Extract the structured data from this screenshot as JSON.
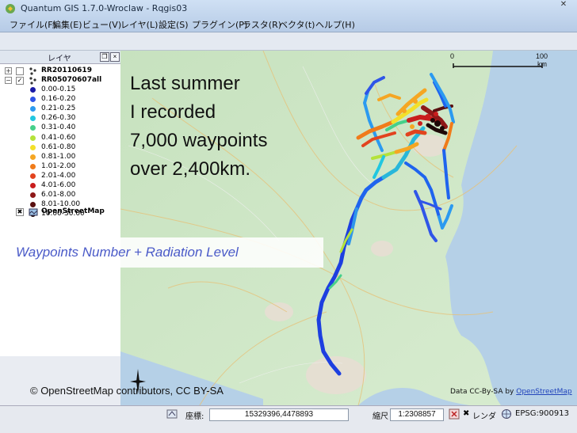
{
  "window": {
    "title": "Quantum GIS 1.7.0-Wroclaw - Rqgis03",
    "close_glyph": "✕"
  },
  "menu": [
    "ファイル(F)",
    "編集(E)",
    "ビュー(V)",
    "レイヤ(L)",
    "設定(S)",
    "プラグイン(P)",
    "ラスタ(R)",
    "ベクタ(t)",
    "ヘルプ(H)"
  ],
  "layers_panel": {
    "title": "レイヤ",
    "layers": [
      {
        "name": "RR20110619",
        "bold": true,
        "expander": "+"
      },
      {
        "name": "RR05070607all",
        "bold": true,
        "expander": "−"
      },
      {
        "name": "0.00-0.15",
        "color": "#1a1aa6"
      },
      {
        "name": "0.16-0.20",
        "color": "#2f55e8"
      },
      {
        "name": "0.21-0.25",
        "color": "#2b9af0"
      },
      {
        "name": "0.26-0.30",
        "color": "#21c7e0"
      },
      {
        "name": "0.31-0.40",
        "color": "#46d08a"
      },
      {
        "name": "0.41-0.60",
        "color": "#b4e23a"
      },
      {
        "name": "0.61-0.80",
        "color": "#f3e02a"
      },
      {
        "name": "0.81-1.00",
        "color": "#f5a623"
      },
      {
        "name": "1.01-2.00",
        "color": "#f07b1a"
      },
      {
        "name": "2.01-4.00",
        "color": "#e2431e"
      },
      {
        "name": "4.01-6.00",
        "color": "#c91d1d"
      },
      {
        "name": "6.01-8.00",
        "color": "#8e1818"
      },
      {
        "name": "8.01-10.00",
        "color": "#5a1010"
      },
      {
        "name": "10.00-30.00",
        "color": "#1e0707"
      },
      {
        "name": "OpenStreetMap",
        "bold": true,
        "raster": true
      }
    ]
  },
  "map": {
    "scale_left": "0",
    "scale_right": "100",
    "scale_unit": "km"
  },
  "slide_text": {
    "lines": [
      "Last summer",
      "I recorded",
      "7,000 waypoints",
      "over 2,400km."
    ],
    "banner": "Waypoints Number  +  Radiation Level",
    "credit": "© OpenStreetMap contributors, CC BY-SA",
    "attribution_prefix": "Data CC-By-SA by ",
    "attribution_link": "OpenStreetMap"
  },
  "status_bar": {
    "coord_label": "座標:",
    "coordinates": "15329396,4478893",
    "scale_label": "縮尺",
    "scale": "1:2308857",
    "render_label": "レンダ",
    "render_checked": "✖",
    "crs": "EPSG:900913"
  },
  "colors": {
    "track_low": "#1d3fe0",
    "track_high": "#b71414",
    "banner_text": "#4a5ac8"
  }
}
